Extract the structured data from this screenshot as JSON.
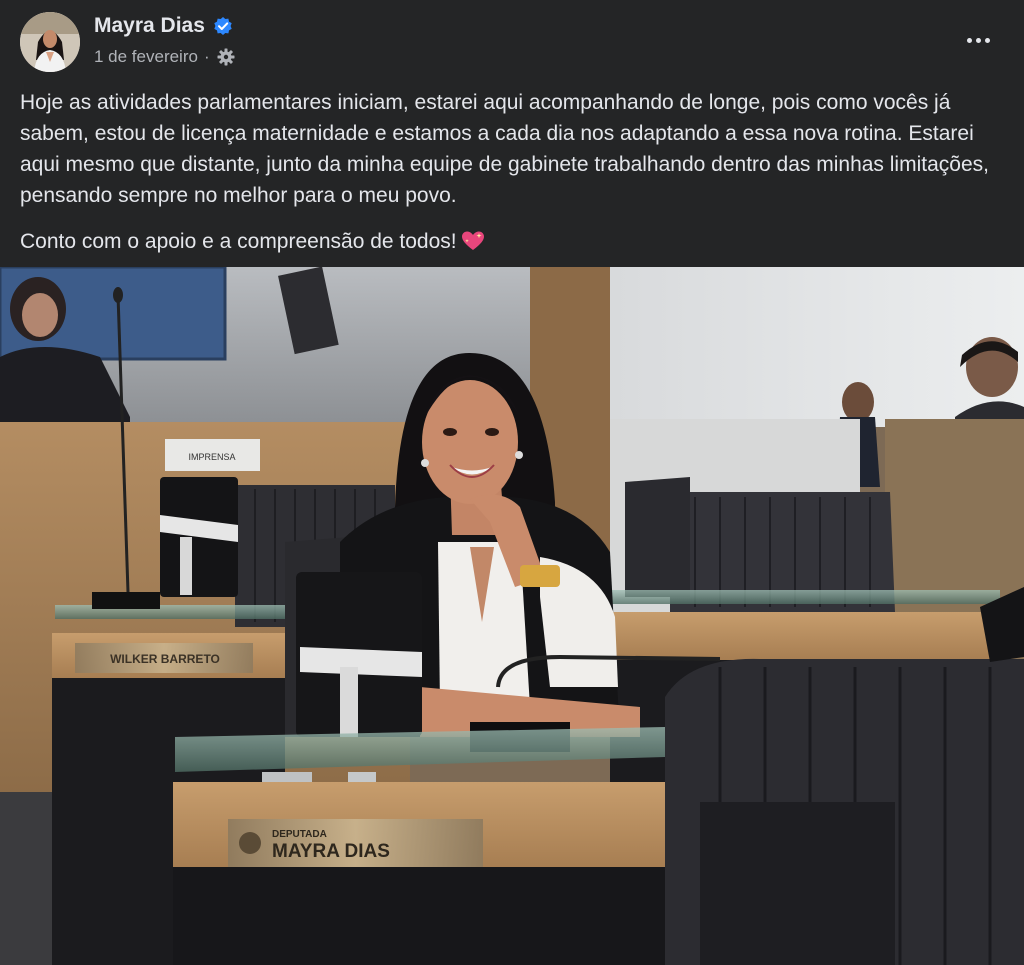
{
  "post": {
    "author": {
      "name": "Mayra Dias",
      "verified_icon": "verified-badge-icon",
      "avatar_icon": "avatar"
    },
    "meta": {
      "date": "1 de fevereiro",
      "separator": "·",
      "audience_icon": "gear-icon"
    },
    "menu_icon": "more-options-icon",
    "text": {
      "paragraph_1": "Hoje as atividades parlamentares iniciam, estarei aqui acompanhando de longe, pois como vocês já sabem, estou de licença maternidade e estamos a cada dia nos adaptando a essa nova rotina. Estarei aqui mesmo que distante, junto da minha equipe de gabinete trabalhando dentro das minhas limitações, pensando sempre no melhor para o meu povo.",
      "paragraph_2": "Conto com o apoio e a compreensão de todos!",
      "emoji_icon": "sparkling-heart-icon"
    },
    "photo": {
      "nameplate_front_title": "DEPUTADA",
      "nameplate_front_name": "MAYRA DIAS",
      "nameplate_back_name": "WILKER BARRETO",
      "sign_text": "IMPRENSA"
    },
    "colors": {
      "background": "#242526",
      "text_primary": "#e4e6eb",
      "text_secondary": "#b0b3b8",
      "verified_blue": "#2d88ff"
    }
  }
}
